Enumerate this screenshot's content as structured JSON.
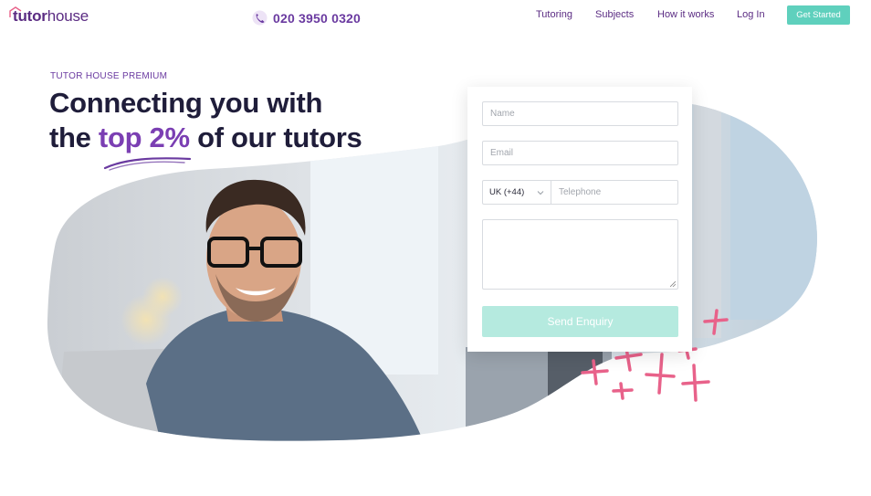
{
  "header": {
    "logo_prefix": "tutor",
    "logo_suffix": "house",
    "phone": "020 3950 0320",
    "nav": [
      "Tutoring",
      "Subjects",
      "How it works",
      "Log In"
    ],
    "cta": "Get Started"
  },
  "hero": {
    "eyebrow": "TUTOR HOUSE PREMIUM",
    "line1": "Connecting you with",
    "line2_pre": "the ",
    "line2_accent": "top 2%",
    "line2_post": " of our tutors"
  },
  "form": {
    "name_placeholder": "Name",
    "email_placeholder": "Email",
    "country_code": "UK (+44)",
    "telephone_placeholder": "Telephone",
    "message_value": "",
    "submit_label": "Send Enquiry"
  },
  "colors": {
    "brand_purple": "#5b2c83",
    "accent_purple": "#7b3fb3",
    "teal": "#5fd0bd",
    "teal_disabled": "#b5eadf",
    "pink": "#e8628a"
  },
  "icons": [
    "house-logo-icon",
    "phone-icon",
    "chevron-down-icon",
    "resize-grip-icon",
    "scribble-underline",
    "pink-crosses-decoration"
  ]
}
